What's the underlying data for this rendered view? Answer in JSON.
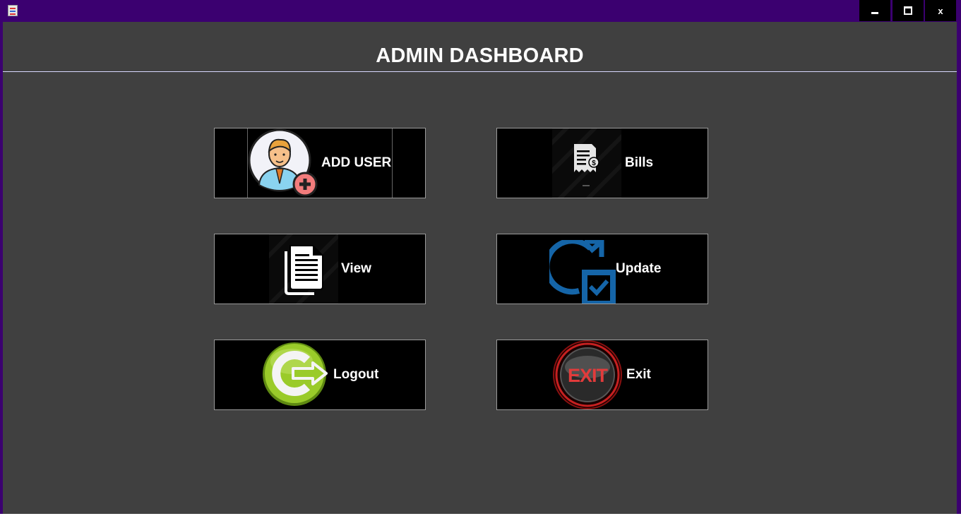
{
  "window": {
    "minimize_icon": "minimize-icon",
    "maximize_icon": "maximize-icon",
    "close_icon": "close-icon",
    "close_glyph": "x"
  },
  "page": {
    "title": "ADMIN DASHBOARD"
  },
  "tiles": [
    {
      "label": "ADD USER",
      "icon": "add-user-icon"
    },
    {
      "label": "Bills",
      "icon": "bill-receipt-icon"
    },
    {
      "label": "View",
      "icon": "document-icon"
    },
    {
      "label": "Update",
      "icon": "refresh-check-icon"
    },
    {
      "label": "Logout",
      "icon": "logout-arrow-icon"
    },
    {
      "label": "Exit",
      "icon": "exit-button-icon"
    }
  ],
  "colors": {
    "titlebar": "#3b0070",
    "panel": "#404040",
    "tile": "#000000",
    "update_blue": "#1565a8",
    "logout_green": "#8cbf1f",
    "exit_red": "#e23b3b"
  }
}
